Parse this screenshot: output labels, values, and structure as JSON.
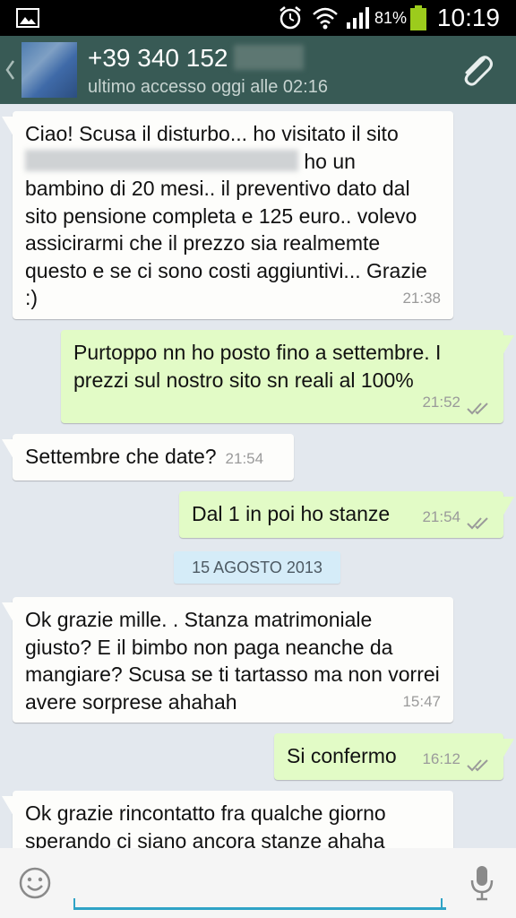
{
  "status_bar": {
    "battery_percent": "81%",
    "time": "10:19",
    "icons": [
      "image-icon",
      "alarm-icon",
      "wifi-icon",
      "signal-icon",
      "battery-icon"
    ]
  },
  "header": {
    "contact_name": "+39 340 152",
    "last_seen": "ultimo accesso oggi alle 02:16",
    "icons": [
      "back-chevron-icon",
      "avatar",
      "paperclip-icon"
    ]
  },
  "messages": [
    {
      "direction": "in",
      "text_before_blur": "Ciao!  Scusa il disturbo... ho visitato il sito",
      "text_after_blur": " ho un",
      "text_rest": "bambino di 20 mesi.. il preventivo dato dal sito pensione completa e 125 euro.. volevo assicirarmi che il prezzo sia realmemte questo e se ci sono costi aggiuntivi... Grazie :)",
      "time": "21:38"
    },
    {
      "direction": "out",
      "text": "Purtoppo nn ho posto fino a settembre. I prezzi sul nostro sito sn reali al 100%",
      "time": "21:52",
      "status": "read"
    },
    {
      "direction": "in",
      "text": "Settembre che date?",
      "time": "21:54"
    },
    {
      "direction": "out",
      "text": "Dal 1 in poi ho stanze",
      "time": "21:54",
      "status": "read"
    },
    {
      "direction": "in",
      "text": "Ok grazie mille. . Stanza matrimoniale giusto? E il bimbo non paga neanche da mangiare? Scusa se ti tartasso ma non vorrei avere sorprese ahahah",
      "time": "15:47"
    },
    {
      "direction": "out",
      "text": "Si confermo",
      "time": "16:12",
      "status": "read"
    },
    {
      "direction": "in",
      "text": "Ok grazie rincontatto fra qualche giorno sperando ci siano ancora stanze ahaha"
    }
  ],
  "date_separator": "15 AGOSTO 2013",
  "input_bar": {
    "message_value": "",
    "icons": [
      "emoji-icon",
      "microphone-icon"
    ]
  },
  "colors": {
    "header_bg": "#385a55",
    "chat_bg": "#e3e8ee",
    "incoming_bubble": "#fdfdfb",
    "outgoing_bubble": "#e2fbc6",
    "read_ticks": "#9a9a9a",
    "input_underline": "#2fa3c6"
  }
}
